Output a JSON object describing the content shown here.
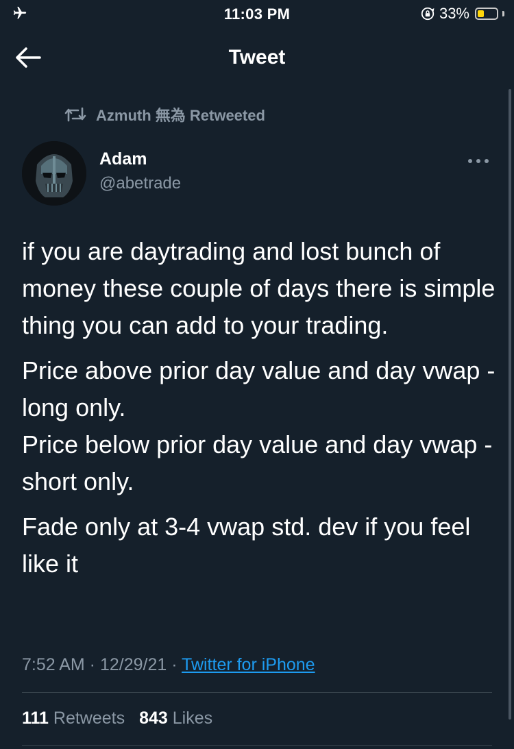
{
  "status_bar": {
    "time": "11:03 PM",
    "battery_percent": "33%",
    "battery_level": 0.33,
    "icons": [
      "airplane-icon",
      "rotation-lock-icon",
      "battery-icon"
    ]
  },
  "nav": {
    "title": "Tweet",
    "back_icon": "arrow-left-icon"
  },
  "retweet_context": {
    "icon": "retweet-icon",
    "text": "Azmuth 無為 Retweeted"
  },
  "author": {
    "name": "Adam",
    "handle": "@abetrade"
  },
  "tweet": {
    "paragraphs": [
      "if you are daytrading and lost bunch of money these couple of days there is simple thing you can add to your trading.",
      "Price above prior day value and day vwap - long only.\nPrice below prior day value and day vwap - short only.",
      "Fade only at 3-4 vwap std. dev if you feel like it"
    ]
  },
  "meta": {
    "time": "7:52 AM",
    "date": "12/29/21",
    "separator": " · ",
    "source": "Twitter for iPhone"
  },
  "stats": {
    "retweets_count": "111",
    "retweets_label": "Retweets",
    "likes_count": "843",
    "likes_label": "Likes"
  },
  "colors": {
    "background": "#15202b",
    "secondary_text": "#8b98a5",
    "link": "#1d9bf0",
    "battery": "#ffd60a"
  }
}
